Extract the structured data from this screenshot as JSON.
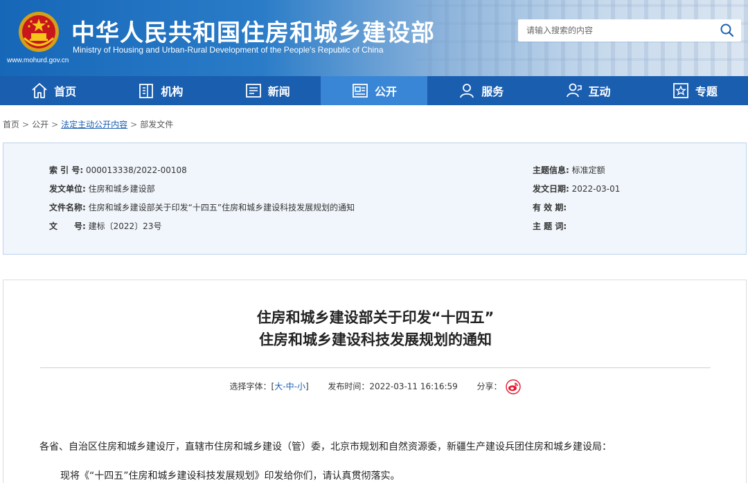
{
  "header": {
    "title": "中华人民共和国住房和城乡建设部",
    "subtitle": "Ministry of Housing and Urban-Rural Development of the People's Republic of China",
    "url": "www.mohurd.gov.cn",
    "search_placeholder": "请输入搜索的内容"
  },
  "nav": {
    "items": [
      {
        "label": "首页",
        "icon": "home-icon"
      },
      {
        "label": "机构",
        "icon": "building-icon"
      },
      {
        "label": "新闻",
        "icon": "news-icon"
      },
      {
        "label": "公开",
        "icon": "open-icon"
      },
      {
        "label": "服务",
        "icon": "service-icon"
      },
      {
        "label": "互动",
        "icon": "interaction-icon"
      },
      {
        "label": "专题",
        "icon": "star-icon"
      }
    ],
    "active": "公开"
  },
  "breadcrumb": {
    "home": "首页",
    "sep": ">",
    "level1": "公开",
    "level2": "法定主动公开内容",
    "level3": "部发文件"
  },
  "info": {
    "index_label": "索 引 号:",
    "index_value": "000013338/2022-00108",
    "issuer_label": "发文单位:",
    "issuer_value": "住房和城乡建设部",
    "filename_label": "文件名称:",
    "filename_value": "住房和城乡建设部关于印发“十四五”住房和城乡建设科技发展规划的通知",
    "docno_label": "文　　号:",
    "docno_value": "建标〔2022〕23号",
    "topic_label": "主题信息:",
    "topic_value": "标准定额",
    "date_label": "发文日期:",
    "date_value": "2022-03-01",
    "valid_label": "有 效 期:",
    "valid_value": "",
    "keywords_label": "主 题 词:",
    "keywords_value": ""
  },
  "article": {
    "title_line1": "住房和城乡建设部关于印发“十四五”",
    "title_line2": "住房和城乡建设科技发展规划的通知",
    "font_label": "选择字体：[",
    "font_large": "大",
    "font_medium": "中",
    "font_small": "小",
    "font_dash": "-",
    "font_close": "]",
    "publish_label": "发布时间：",
    "publish_time": "2022-03-11 16:16:59",
    "share_label": "分享：",
    "para1": "各省、自治区住房和城乡建设厅，直辖市住房和城乡建设（管）委，北京市规划和自然资源委，新疆生产建设兵团住房和城乡建设局：",
    "para2": "现将《“十四五”住房和城乡建设科技发展规划》印发给你们，请认真贯彻落实。"
  },
  "colors": {
    "nav_bg": "#1a5eb0",
    "nav_active": "#3a86d6",
    "link": "#1a5eb0",
    "weibo_red": "#e6162d"
  }
}
